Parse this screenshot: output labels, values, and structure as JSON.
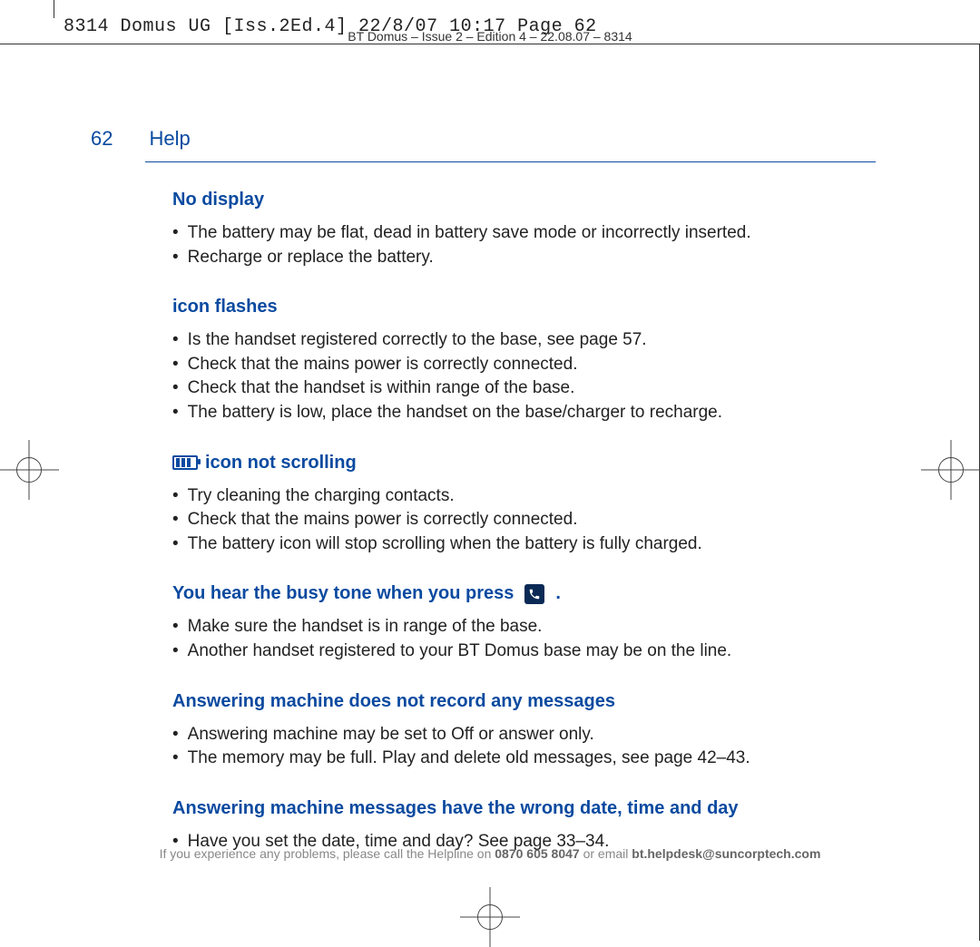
{
  "print": {
    "mono_header": "8314 Domus UG [Iss.2Ed.4]  22/8/07  10:17  Page 62",
    "small_header": "BT Domus – Issue 2 – Edition 4 – 22.08.07 – 8314"
  },
  "page": {
    "number": "62",
    "section": "Help"
  },
  "sections": {
    "s1_title": "No display",
    "s1_i1": "The battery may be flat, dead in battery save mode or incorrectly inserted.",
    "s1_i2": "Recharge or replace the battery.",
    "s2_title": "icon flashes",
    "s2_i1": "Is the handset registered correctly to the base, see page 57.",
    "s2_i2": "Check that the mains power is correctly connected.",
    "s2_i3": "Check that the handset is within range of the base.",
    "s2_i4": "The battery is low, place the handset on the base/charger to recharge.",
    "s3_title": "icon not scrolling",
    "s3_i1": "Try cleaning the charging contacts.",
    "s3_i2": "Check that the mains power is correctly connected.",
    "s3_i3": "The battery icon will stop scrolling when the battery is fully charged.",
    "s4_title_a": "You hear the busy tone when you press",
    "s4_title_b": ".",
    "s4_i1": "Make sure the handset is in range of the base.",
    "s4_i2": "Another handset registered to your BT Domus base may be on the line.",
    "s5_title": "Answering machine does not record any messages",
    "s5_i1": "Answering machine may be set to Off or answer only.",
    "s5_i2": "The memory may be full. Play and delete old messages, see page 42–43.",
    "s6_title": "Answering machine messages have the wrong date, time and day",
    "s6_i1": "Have you set the date, time and day? See page 33–34."
  },
  "footer": {
    "pre": "If you experience any problems, please call the Helpline on ",
    "phone": "0870 605 8047",
    "mid": " or email ",
    "email": "bt.helpdesk@suncorptech.com"
  }
}
